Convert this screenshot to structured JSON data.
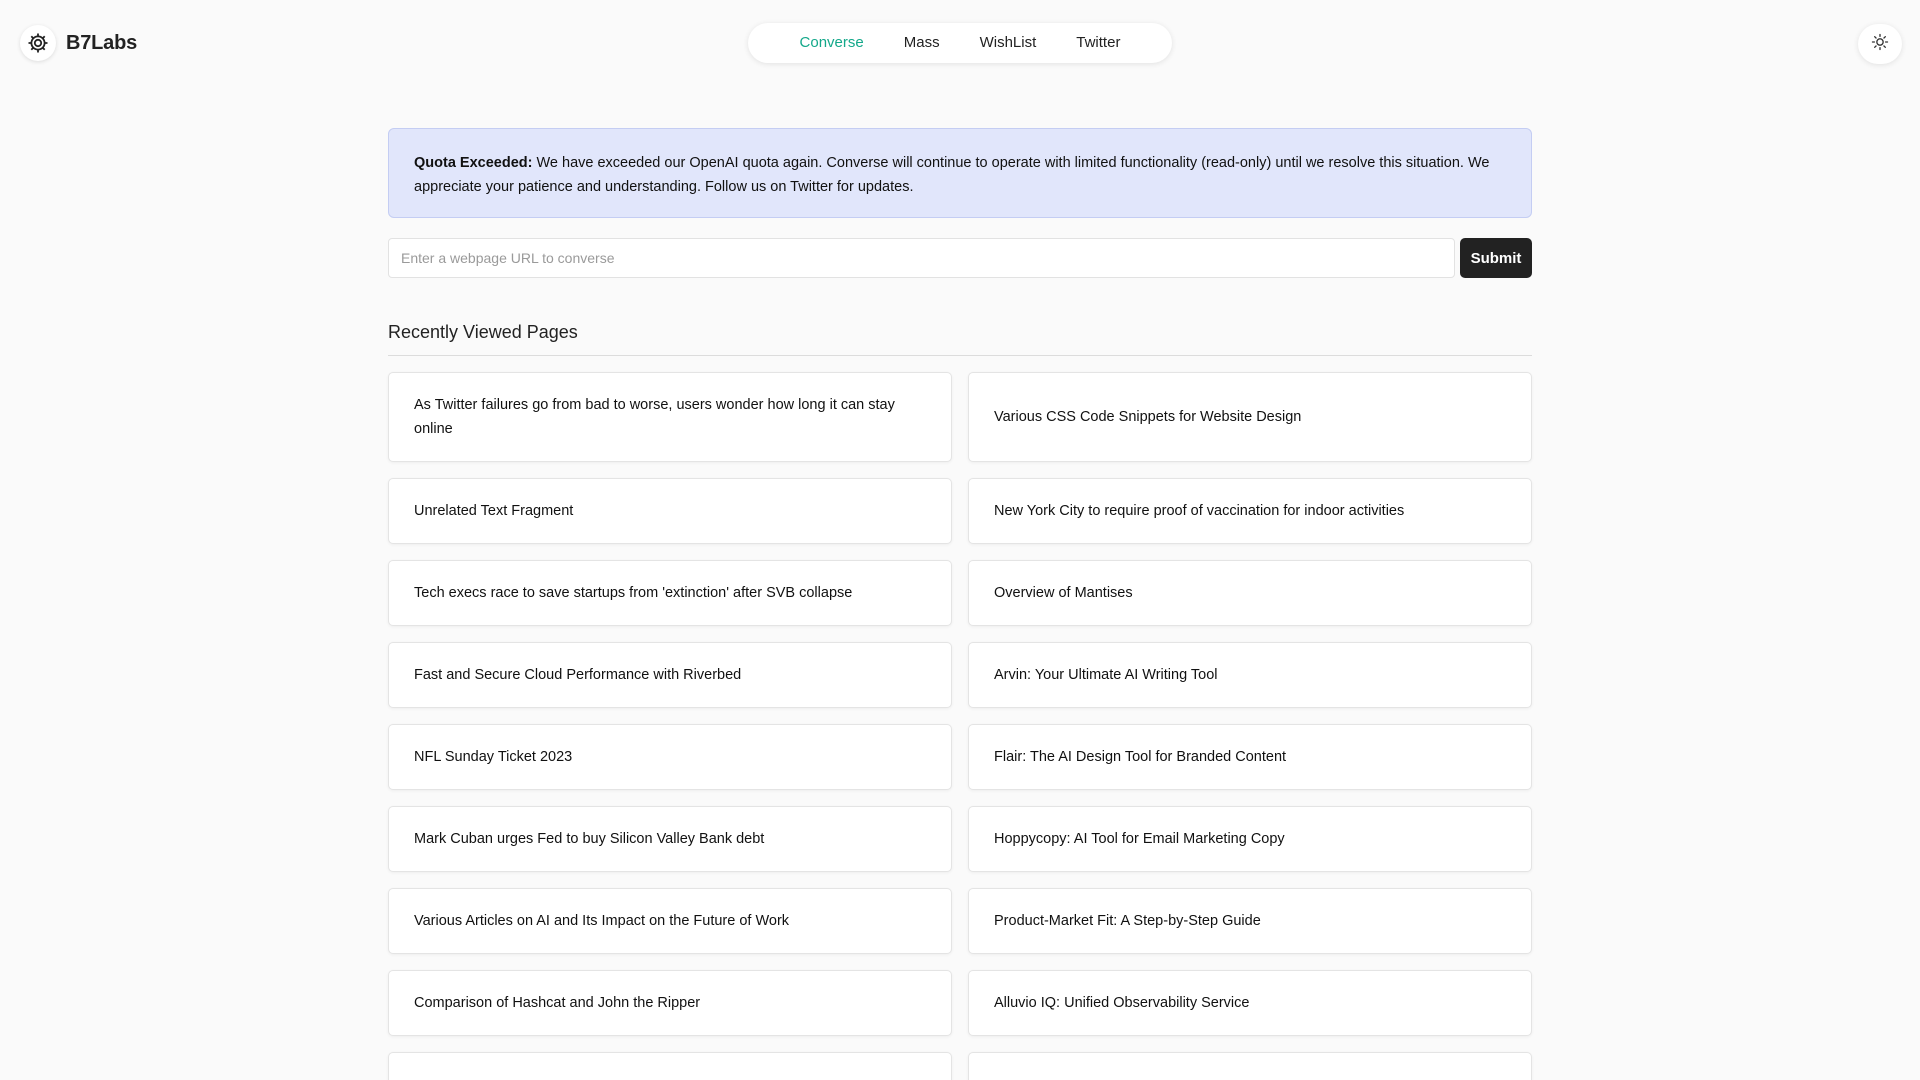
{
  "brand": {
    "name": "B7Labs",
    "logo_icon": "gear-icon"
  },
  "nav": {
    "items": [
      {
        "label": "Converse",
        "active": true
      },
      {
        "label": "Mass",
        "active": false
      },
      {
        "label": "WishList",
        "active": false
      },
      {
        "label": "Twitter",
        "active": false
      }
    ],
    "accent_color": "#14a88a"
  },
  "theme_toggle": {
    "icon": "sun-icon"
  },
  "alert": {
    "title": "Quota Exceeded:",
    "message": "We have exceeded our OpenAI quota again. Converse will continue to operate with limited functionality (read-only) until we resolve this situation. We appreciate your patience and understanding. Follow us on Twitter for updates."
  },
  "url_form": {
    "placeholder": "Enter a webpage URL to converse",
    "value": "",
    "submit_label": "Submit"
  },
  "recent": {
    "title": "Recently Viewed Pages",
    "pages": [
      "As Twitter failures go from bad to worse, users wonder how long it can stay online",
      "Various CSS Code Snippets for Website Design",
      "Unrelated Text Fragment",
      "New York City to require proof of vaccination for indoor activities",
      "Tech execs race to save startups from 'extinction' after SVB collapse",
      "Overview of Mantises",
      "Fast and Secure Cloud Performance with Riverbed",
      "Arvin: Your Ultimate AI Writing Tool",
      "NFL Sunday Ticket 2023",
      "Flair: The AI Design Tool for Branded Content",
      "Mark Cuban urges Fed to buy Silicon Valley Bank debt",
      "Hoppycopy: AI Tool for Email Marketing Copy",
      "Various Articles on AI and Its Impact on the Future of Work",
      "Product-Market Fit: A Step-by-Step Guide",
      "Comparison of Hashcat and John the Ripper",
      "Alluvio IQ: Unified Observability Service",
      "",
      ""
    ]
  }
}
